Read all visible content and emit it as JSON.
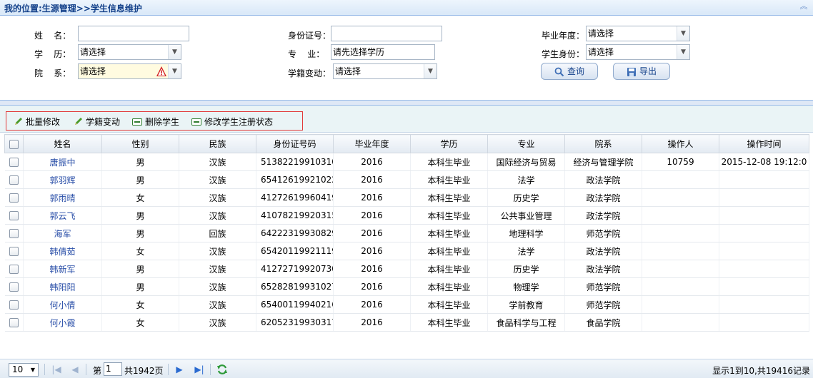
{
  "breadcrumb": "我的位置:生源管理>>学生信息维护",
  "form": {
    "name_label": "姓    名：",
    "idcard_label": "身份证号：",
    "grad_year_label": "毕业年度：",
    "grad_year_value": "请选择",
    "education_label": "学    历：",
    "education_value": "请选择",
    "major_label": "专    业：",
    "major_value": "请先选择学历",
    "student_status_label": "学生身份：",
    "student_status_value": "请选择",
    "college_label": "院    系：",
    "college_value": "请选择",
    "change_label": "学籍变动：",
    "change_value": "请选择",
    "search_label": "查询",
    "export_label": "导出"
  },
  "toolbar": {
    "batch_edit": "批量修改",
    "status_change": "学籍变动",
    "delete_student": "删除学生",
    "edit_register": "修改学生注册状态"
  },
  "table": {
    "headers": [
      "姓名",
      "性别",
      "民族",
      "身份证号码",
      "毕业年度",
      "学历",
      "专业",
      "院系",
      "操作人",
      "操作时间"
    ],
    "rows": [
      [
        "唐振中",
        "男",
        "汉族",
        "51382219910310",
        "2016",
        "本科生毕业",
        "国际经济与贸易",
        "经济与管理学院",
        "10759",
        "2015-12-08 19:12:0"
      ],
      [
        "郭羽辉",
        "男",
        "汉族",
        "65412619921022",
        "2016",
        "本科生毕业",
        "法学",
        "政法学院",
        "",
        ""
      ],
      [
        "郭雨晴",
        "女",
        "汉族",
        "41272619960419",
        "2016",
        "本科生毕业",
        "历史学",
        "政法学院",
        "",
        ""
      ],
      [
        "郭云飞",
        "男",
        "汉族",
        "41078219920315",
        "2016",
        "本科生毕业",
        "公共事业管理",
        "政法学院",
        "",
        ""
      ],
      [
        "海军",
        "男",
        "回族",
        "64222319930829",
        "2016",
        "本科生毕业",
        "地理科学",
        "师范学院",
        "",
        ""
      ],
      [
        "韩倩茹",
        "女",
        "汉族",
        "65420119921119",
        "2016",
        "本科生毕业",
        "法学",
        "政法学院",
        "",
        ""
      ],
      [
        "韩新军",
        "男",
        "汉族",
        "41272719920730",
        "2016",
        "本科生毕业",
        "历史学",
        "政法学院",
        "",
        ""
      ],
      [
        "韩阳阳",
        "男",
        "汉族",
        "65282819931027",
        "2016",
        "本科生毕业",
        "物理学",
        "师范学院",
        "",
        ""
      ],
      [
        "何小倩",
        "女",
        "汉族",
        "65400119940216",
        "2016",
        "本科生毕业",
        "学前教育",
        "师范学院",
        "",
        ""
      ],
      [
        "何小霞",
        "女",
        "汉族",
        "62052319930317",
        "2016",
        "本科生毕业",
        "食品科学与工程",
        "食品学院",
        "",
        ""
      ]
    ]
  },
  "pager": {
    "page_size": "10",
    "page_prefix": "第",
    "page_value": "1",
    "page_total": "共1942页",
    "info": "显示1到10,共19416记录"
  },
  "colors": {
    "accent": "#15428b",
    "link": "#2a4fa8",
    "highlight_border": "#e23a3a"
  }
}
